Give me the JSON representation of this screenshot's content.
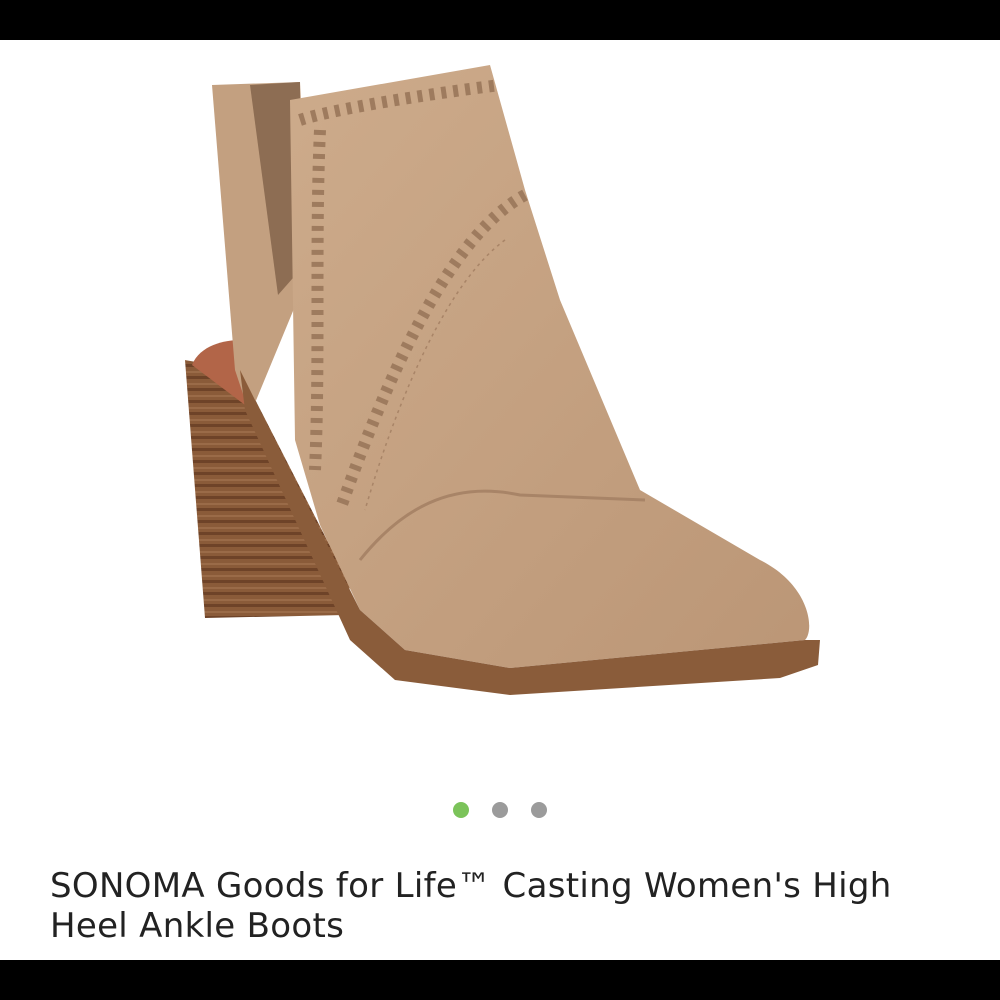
{
  "product": {
    "title": "SONOMA Goods for Life™ Casting Women's High Heel Ankle Boots",
    "image_alt": "Tan faux-suede ankle boot with stacked wood heel"
  },
  "carousel": {
    "total": 3,
    "active_index": 0,
    "active_color": "#7bc35a",
    "inactive_color": "#9b9b9b"
  },
  "colors": {
    "boot": "#c7a585",
    "sole": "#8a5c3a",
    "heel": "#7a4f31"
  }
}
